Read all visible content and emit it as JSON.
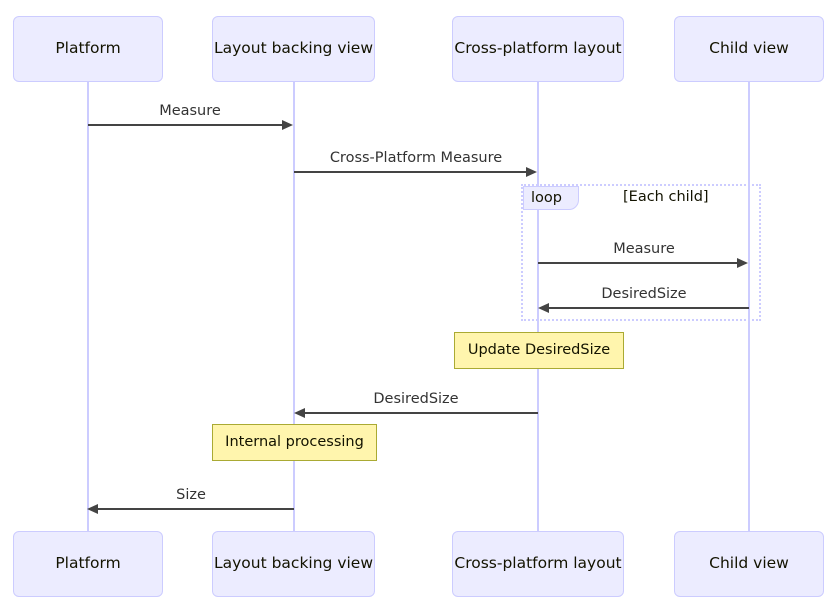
{
  "diagram": {
    "type": "sequence-diagram",
    "colors": {
      "participant_fill": "#ECECFF",
      "participant_border": "#CCCCFF",
      "lifeline": "#CCCCFF",
      "message_line": "#444444",
      "note_fill": "#FFF5AD",
      "note_border": "#AAAA33",
      "text": "#131300",
      "loop_border": "#CCCCFF"
    },
    "participants": [
      {
        "id": "platform",
        "label": "Platform"
      },
      {
        "id": "backing",
        "label": "Layout backing view"
      },
      {
        "id": "crossplatform",
        "label": "Cross-platform layout"
      },
      {
        "id": "child",
        "label": "Child view"
      }
    ],
    "messages": [
      {
        "id": "m1",
        "label": "Measure",
        "from": "platform",
        "to": "backing",
        "direction": "right"
      },
      {
        "id": "m2",
        "label": "Cross-Platform Measure",
        "from": "backing",
        "to": "crossplatform",
        "direction": "right"
      },
      {
        "id": "m3",
        "label": "Measure",
        "from": "crossplatform",
        "to": "child",
        "direction": "right"
      },
      {
        "id": "m4",
        "label": "DesiredSize",
        "from": "child",
        "to": "crossplatform",
        "direction": "left"
      },
      {
        "id": "m5",
        "label": "DesiredSize",
        "from": "crossplatform",
        "to": "backing",
        "direction": "left"
      },
      {
        "id": "m6",
        "label": "Size",
        "from": "backing",
        "to": "platform",
        "direction": "left"
      }
    ],
    "fragments": [
      {
        "id": "loop1",
        "kind": "loop",
        "condition": "[Each child]"
      }
    ],
    "notes": [
      {
        "id": "note1",
        "label": "Update DesiredSize",
        "over": "crossplatform"
      },
      {
        "id": "note2",
        "label": "Internal processing",
        "over": "backing"
      }
    ]
  }
}
